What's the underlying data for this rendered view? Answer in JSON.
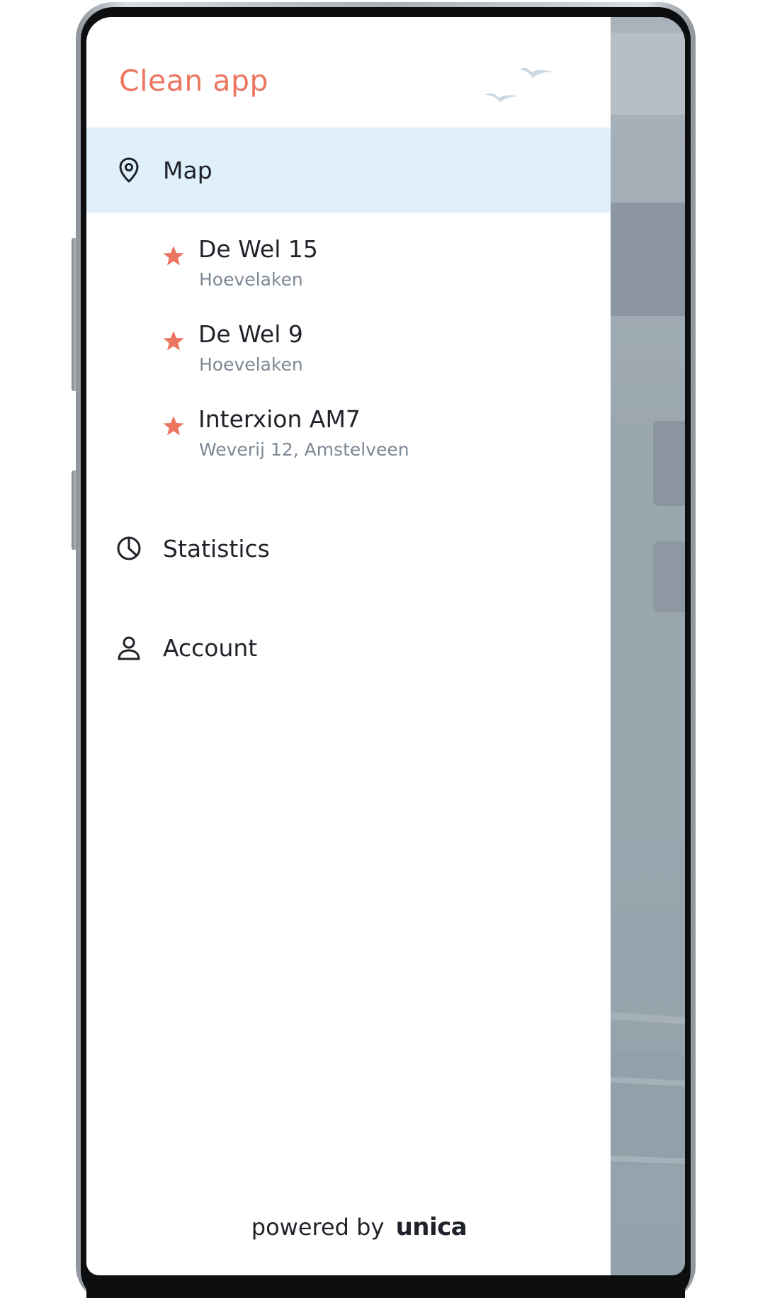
{
  "app": {
    "title": "Clean app"
  },
  "menu": {
    "map_label": "Map",
    "statistics_label": "Statistics",
    "account_label": "Account"
  },
  "locations": [
    {
      "name": "De Wel 15",
      "place": "Hoevelaken"
    },
    {
      "name": "De Wel 9",
      "place": "Hoevelaken"
    },
    {
      "name": "Interxion AM7",
      "place": "Weverij 12, Amstelveen"
    }
  ],
  "footer": {
    "prefix": "powered by",
    "brand": "unica"
  },
  "icons": {
    "map": "map-pin-icon",
    "favorite": "star-icon",
    "statistics": "pie-chart-icon",
    "account": "user-icon",
    "decoration": "birds-icon"
  },
  "colors": {
    "accent": "#ec7660",
    "active_background": "#dff0fb",
    "text_primary": "#1f2329",
    "text_secondary": "#7d8894"
  }
}
